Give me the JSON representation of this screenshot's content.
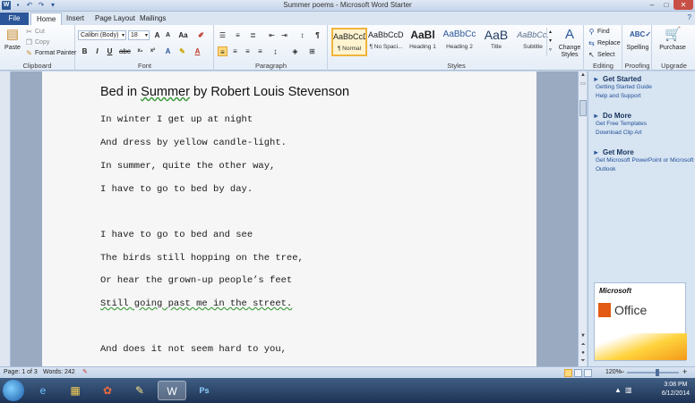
{
  "window": {
    "title": "Summer poems - Microsoft Word Starter",
    "app_icon": "word-icon",
    "help": "?"
  },
  "tabs": [
    {
      "label": "File"
    },
    {
      "label": "Home"
    },
    {
      "label": "Insert"
    },
    {
      "label": "Page Layout"
    },
    {
      "label": "Mailings"
    }
  ],
  "clipboard": {
    "paste": "Paste",
    "cut": "Cut",
    "copy": "Copy",
    "format_painter": "Format Painter",
    "label": "Clipboard"
  },
  "font": {
    "name": "Calibri (Body)",
    "size": "18",
    "bold": "B",
    "italic": "I",
    "underline": "U",
    "label": "Font"
  },
  "paragraph": {
    "label": "Paragraph",
    "show_marks": "¶"
  },
  "styles": {
    "label": "Styles",
    "items": [
      {
        "preview": "AaBbCcDc",
        "name": "¶ Normal"
      },
      {
        "preview": "AaBbCcDc",
        "name": "¶ No Spaci..."
      },
      {
        "preview": "AaBl",
        "name": "Heading 1"
      },
      {
        "preview": "AaBbCc",
        "name": "Heading 2"
      },
      {
        "preview": "AaB",
        "name": "Title"
      },
      {
        "preview": "AaBbCc.",
        "name": "Subtitle"
      }
    ],
    "change_styles": "Change Styles"
  },
  "editing": {
    "find": "Find",
    "replace": "Replace",
    "select": "Select",
    "label": "Editing"
  },
  "proofing": {
    "spelling": "Spelling",
    "label": "Proofing"
  },
  "upgrade": {
    "purchase": "Purchase",
    "label": "Upgrade"
  },
  "document": {
    "title_pre": "Bed in ",
    "title_sq": "Summer",
    "title_post": " by Robert Louis Stevenson",
    "lines": [
      "In winter I get up at night",
      "And dress by yellow candle-light.",
      "In summer, quite the other way,",
      "I have to go to bed by day.",
      "I have to go to bed and see",
      "The birds still hopping on the tree,",
      "Or hear the grown-up people’s feet",
      "Still going past me in the street.",
      "And does it not seem hard to you,"
    ]
  },
  "taskpane": {
    "get_started": {
      "heading": "Get Started",
      "links": [
        "Getting Started Guide",
        "Help and Support"
      ]
    },
    "do_more": {
      "heading": "Do More",
      "links": [
        "Get Free Templates",
        "Download Clip Art"
      ]
    },
    "get_more": {
      "heading": "Get More",
      "links": [
        "Get Microsoft PowerPoint or Microsoft Outlook"
      ]
    },
    "ad": {
      "brand": "Microsoft",
      "product": "Office"
    }
  },
  "status": {
    "page": "Page: 1 of 3",
    "words": "Words: 242",
    "zoom": "120%",
    "zoom_minus": "−",
    "zoom_plus": "+"
  },
  "taskbar": {
    "time": "3:08 PM",
    "date": "6/12/2014"
  },
  "colors": {
    "accent": "#2b579a",
    "selected_style": "#f0b43c",
    "grammar_underline": "#3a9a3a"
  }
}
